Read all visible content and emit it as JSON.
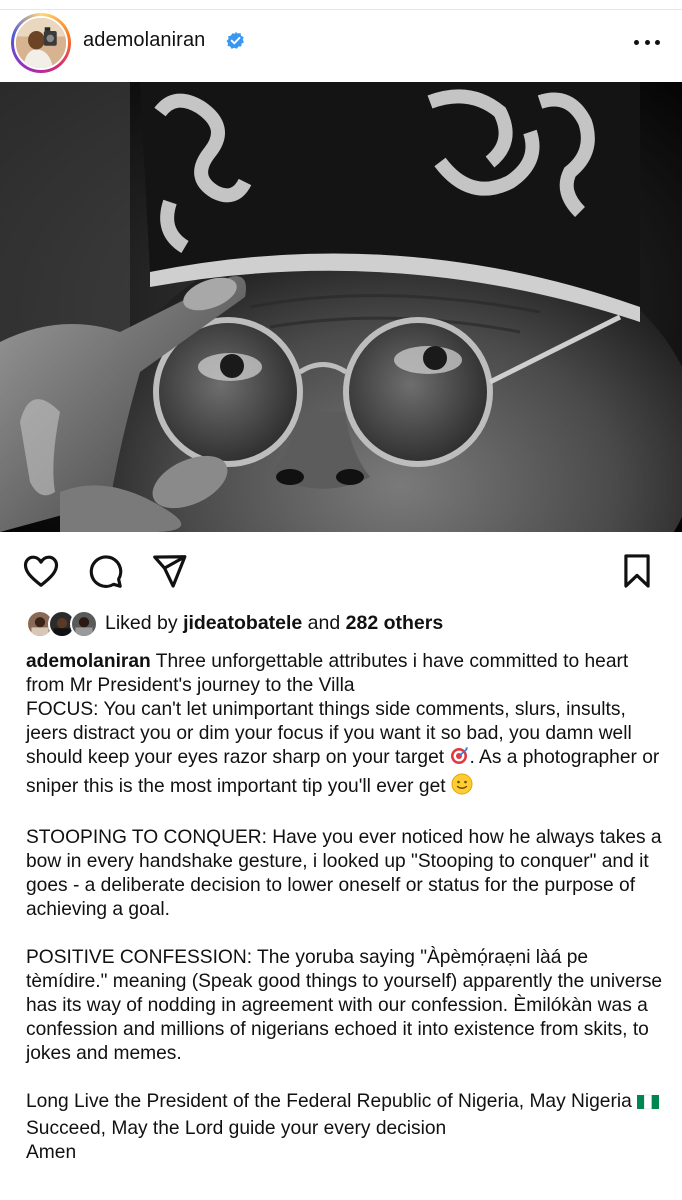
{
  "post": {
    "username": "ademolaniran",
    "verified": true,
    "more_icon": "more-horizontal-icon",
    "image_alt_icon": "photo"
  },
  "actions": {
    "like_icon": "heart-icon",
    "comment_icon": "comment-icon",
    "share_icon": "share-icon",
    "save_icon": "bookmark-icon"
  },
  "likes": {
    "prefix": "Liked by ",
    "user": "jideatobatele",
    "middle": " and ",
    "others": "282 others"
  },
  "caption": {
    "username": "ademolaniran",
    "intro": " Three unforgettable attributes i have committed to heart from  Mr President's journey to the Villa",
    "focus_a": "FOCUS: You can't let unimportant  things side comments, slurs, insults, jeers distract you or dim your focus if you want it so bad, you damn well should keep your eyes razor sharp on your target ",
    "focus_b": ". As a photographer or sniper this is the most important tip you'll ever get ",
    "stooping": "STOOPING TO CONQUER: Have you ever noticed how he always takes a bow in every handshake gesture, i looked up \"Stooping to conquer\" and it goes - a deliberate decision to lower oneself or status for the purpose of achieving a goal.",
    "positive": "POSITIVE CONFESSION: The yoruba saying \"Àpèmọ́raẹni làá pe tèmídire.\" meaning (Speak good things to yourself) apparently the universe has its way of nodding in agreement with our confession. Èmilókàn was a confession and millions of nigerians echoed it into existence from skits, to jokes and memes.",
    "long_live_a": "Long Live the President of the Federal Republic of Nigeria, May Nigeria ",
    "long_live_b": " Succeed, May the Lord guide your every decision",
    "amen": "Amen"
  },
  "colors": {
    "verified_blue": "#3897f0",
    "text": "#111111",
    "story_ring": [
      "#feda75",
      "#fa7e1e",
      "#d62976",
      "#962fbf",
      "#4f5bd5"
    ]
  }
}
